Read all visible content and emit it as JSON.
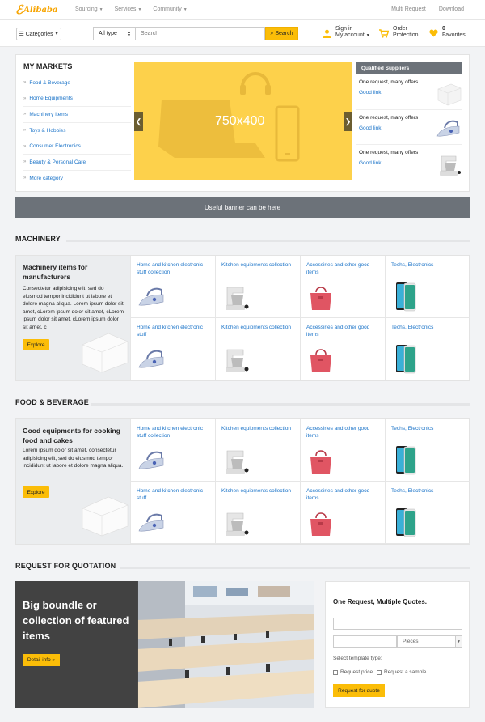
{
  "topbar": {
    "logo_text": "Alibaba",
    "nav": [
      {
        "label": "Sourcing"
      },
      {
        "label": "Services"
      },
      {
        "label": "Community"
      }
    ],
    "right_links": [
      {
        "label": "Multi Request"
      },
      {
        "label": "Download"
      }
    ]
  },
  "header": {
    "categories_label": "Categories",
    "search": {
      "type_value": "All type",
      "placeholder": "Search",
      "button_label": "Search"
    },
    "account": {
      "line1": "Sign in",
      "line2": "My account"
    },
    "order": {
      "line1": "Order",
      "line2": "Protection"
    },
    "favorites": {
      "count": "0",
      "label": "Favorites"
    }
  },
  "markets": {
    "title": "MY MARKETS",
    "items": [
      {
        "label": "Food & Beverage"
      },
      {
        "label": "Home Equipments"
      },
      {
        "label": "Machinery Items"
      },
      {
        "label": "Toys & Hobbies"
      },
      {
        "label": "Consumer Electronics"
      },
      {
        "label": "Beauty & Personal Care"
      },
      {
        "label": "More category"
      }
    ],
    "slider_placeholder": "750x400",
    "suppliers": {
      "title": "Qualified Suppliers",
      "items": [
        {
          "title": "One request, many offers",
          "link": "Good link",
          "image": "box"
        },
        {
          "title": "One request, many offers",
          "link": "Good link",
          "image": "iron"
        },
        {
          "title": "One request, many offers",
          "link": "Good link",
          "image": "mixer"
        }
      ]
    }
  },
  "banner": {
    "text": "Useful banner can be here"
  },
  "sections": [
    {
      "title": "MACHINERY",
      "heading": "Machinery items for manufacturers",
      "text": "Consectetur adipisicing elit, sed do eiusmod tempor incididunt ut labore et dolore magna aliqua. Lorem ipsum dolor sit amet, cLorem ipsum dolor sit amet, cLorem ipsum dolor sit amet, cLorem ipsum dolor sit amet, c",
      "explore": "Explore",
      "cells": [
        {
          "title": "Home and kitchen electronic stuff collection",
          "image": "iron"
        },
        {
          "title": "Kitchen equipments collection",
          "image": "mixer"
        },
        {
          "title": "Accessiries and other good items",
          "image": "bag"
        },
        {
          "title": "Techs, Electronics",
          "image": "phone"
        },
        {
          "title": "Home and kitchen electronic stuff",
          "image": "iron"
        },
        {
          "title": "Kitchen equipments collection",
          "image": "mixer"
        },
        {
          "title": "Accessiries and other good items",
          "image": "bag"
        },
        {
          "title": "Techs, Electronics",
          "image": "phone"
        }
      ]
    },
    {
      "title": "FOOD & BEVERAGE",
      "heading": "Good equipments for cooking food and cakes",
      "text": "Lorem ipsum dolor sit amet, consectetur adipisicing elit, sed do eiusmod tempor incididunt ut labore et dolore magna aliqua.",
      "explore": "Explore",
      "cells": [
        {
          "title": "Home and kitchen electronic stuff collection",
          "image": "iron"
        },
        {
          "title": "Kitchen equipments collection",
          "image": "mixer"
        },
        {
          "title": "Accessiries and other good items",
          "image": "bag"
        },
        {
          "title": "Techs, Electronics",
          "image": "phone"
        },
        {
          "title": "Home and kitchen electronic stuff",
          "image": "iron"
        },
        {
          "title": "Kitchen equipments collection",
          "image": "mixer"
        },
        {
          "title": "Accessiries and other good items",
          "image": "bag"
        },
        {
          "title": "Techs, Electronics",
          "image": "phone"
        }
      ]
    }
  ],
  "rfq": {
    "title": "REQUEST FOR QUOTATION",
    "heading": "Big boundle or collection of featured items",
    "detail_btn": "Detail info »",
    "form": {
      "heading": "One Request, Multiple Quotes.",
      "unit": "Pieces",
      "template_label": "Select template type:",
      "opt1": "Request price",
      "opt2": "Request a sample",
      "submit": "Request for quote"
    }
  },
  "colors": {
    "accent": "#fbbd08",
    "link": "#1a73c8",
    "banner": "#6c7279"
  }
}
